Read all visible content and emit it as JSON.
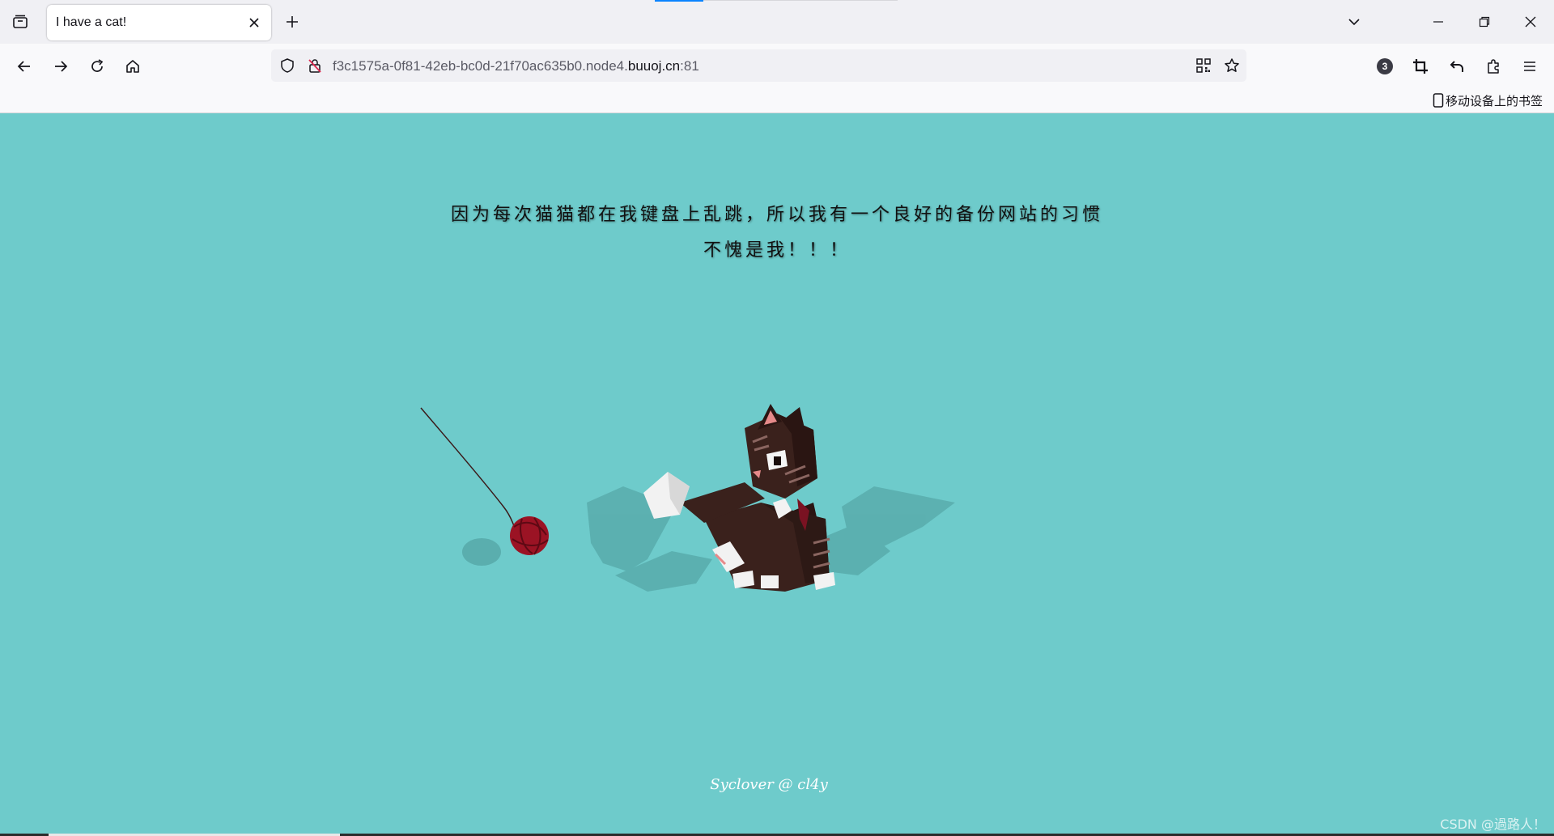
{
  "browser": {
    "tab_title": "I have a cat!",
    "url_prefix": "f3c1575a-0f81-42eb-bc0d-21f70ac635b0.node4.",
    "url_host": "buuoj.cn",
    "url_suffix": ":81",
    "extension_badge": "3",
    "bookmark_mobile": "移动设备上的书签"
  },
  "page": {
    "headline_line1": "因为每次猫猫都在我键盘上乱跳，所以我有一个良好的备份网站的习惯",
    "headline_line2": "不愧是我！！！",
    "credit": "Syclover @ cl4y",
    "watermark": "CSDN @過路人！"
  },
  "colors": {
    "page_bg": "#6ecbcb",
    "cat_body": "#3a211c",
    "yarn": "#9b1324"
  },
  "icons": [
    "tab-list-icon",
    "close-icon",
    "plus-icon",
    "chevron-down-icon",
    "minimize-icon",
    "restore-icon",
    "back-arrow-icon",
    "forward-arrow-icon",
    "reload-icon",
    "home-icon",
    "shield-icon",
    "insecure-lock-icon",
    "qr-code-icon",
    "star-icon",
    "crop-icon",
    "undo-icon",
    "puzzle-icon",
    "menu-icon",
    "mobile-device-icon"
  ]
}
